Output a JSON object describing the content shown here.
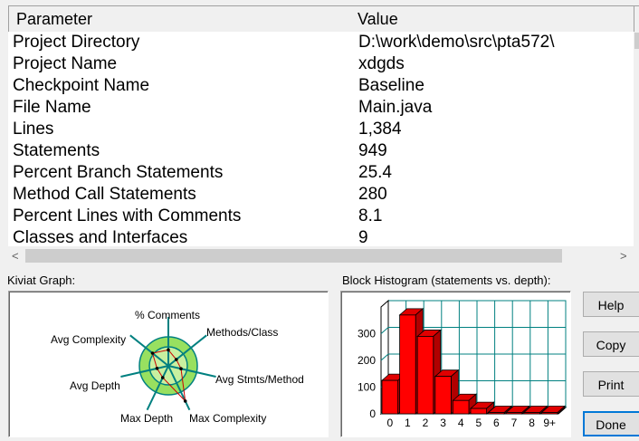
{
  "table": {
    "headers": [
      "Parameter",
      "Value"
    ],
    "rows": [
      {
        "param": "Project Directory",
        "value": "D:\\work\\demo\\src\\pta572\\"
      },
      {
        "param": "Project Name",
        "value": "xdgds"
      },
      {
        "param": "Checkpoint Name",
        "value": "Baseline"
      },
      {
        "param": "File Name",
        "value": "Main.java"
      },
      {
        "param": "Lines",
        "value": "1,384"
      },
      {
        "param": "Statements",
        "value": "949"
      },
      {
        "param": "Percent Branch Statements",
        "value": "25.4"
      },
      {
        "param": "Method Call Statements",
        "value": "280"
      },
      {
        "param": "Percent Lines with Comments",
        "value": "8.1"
      },
      {
        "param": "Classes and Interfaces",
        "value": "9"
      }
    ]
  },
  "scroll": {
    "left_arrow": "<",
    "right_arrow": ">"
  },
  "kiviat": {
    "label": "Kiviat Graph:",
    "axes": [
      "% Comments",
      "Methods/Class",
      "Avg Stmts/Method",
      "Max Complexity",
      "Max Depth",
      "Avg Depth",
      "Avg Complexity"
    ],
    "values": [
      0.55,
      0.35,
      0.45,
      1.35,
      0.45,
      0.4,
      0.7
    ],
    "colors": {
      "outer_band": "#98e060",
      "inner_band": "#c8f0a0",
      "spokes": "#008080",
      "polygon": "#cc0000"
    }
  },
  "chart_data": {
    "type": "bar",
    "title": "Block Histogram (statements vs. depth):",
    "categories": [
      "0",
      "1",
      "2",
      "3",
      "4",
      "5",
      "6",
      "7",
      "8",
      "9+"
    ],
    "values": [
      125,
      370,
      290,
      140,
      50,
      20,
      5,
      5,
      5,
      5
    ],
    "ylim": [
      0,
      400
    ],
    "yticks": [
      0,
      100,
      200,
      300
    ],
    "bar_color": "#ff0000",
    "grid_color": "#008080"
  },
  "buttons": {
    "help": "Help",
    "copy": "Copy",
    "print": "Print",
    "done": "Done"
  }
}
